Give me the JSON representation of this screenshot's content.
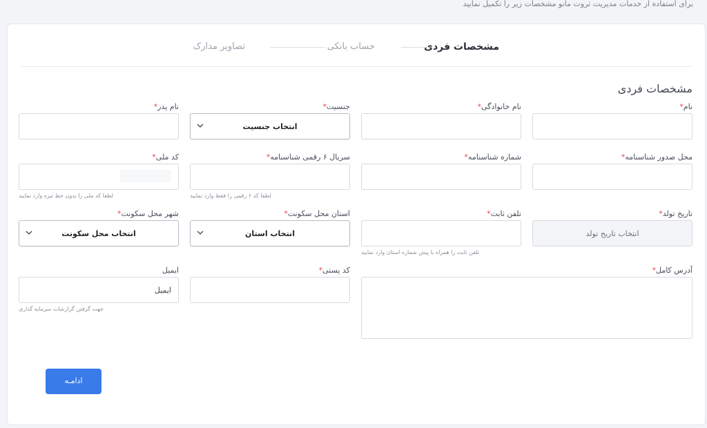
{
  "intro_text": "برای استفاده از خدمات مدیریت ثروت مانو مشخصات زیر را تکمیل نمایید",
  "steps": {
    "personal": "مشخصات فردی",
    "bank": "حساب بانکی",
    "documents": "تصاویر مدارک"
  },
  "section_title": "مشخصات فردی",
  "fields": {
    "first_name": {
      "label": "نام"
    },
    "last_name": {
      "label": "نام خانوادگی"
    },
    "gender": {
      "label": "جنسیت",
      "value": "انتخاب جنسیت"
    },
    "father_name": {
      "label": "نام پدر"
    },
    "issue_place": {
      "label": "محل صدور شناسنامه"
    },
    "id_number": {
      "label": "شماره شناسنامه"
    },
    "id_serial": {
      "label": "سریال ۶ رقمی شناسنامه",
      "hint": "لطفا کد ۶ رقمی را فقط وارد نمایید"
    },
    "national_code": {
      "label": "کد ملی",
      "hint": "لطفا کد ملی را بدون خط تیره وارد نمایید"
    },
    "birth_date": {
      "label": "تاریخ تولد",
      "placeholder": "انتخاب تاریخ تولد"
    },
    "landline": {
      "label": "تلفن ثابت",
      "hint": "تلفن ثابت را همراه با پیش شماره استان وارد نمایید"
    },
    "province": {
      "label": "استان محل سکونت",
      "value": "انتخاب استان"
    },
    "city": {
      "label": "شهر محل سکونت",
      "value": "انتخاب محل سکونت"
    },
    "address": {
      "label": "آدرس کامل"
    },
    "postal_code": {
      "label": "کد پستی"
    },
    "email": {
      "label": "ایمیل",
      "placeholder": "ایمیل",
      "hint": "جهت گرفتن گزارشات سرمایه گذاری"
    }
  },
  "continue_label": "ادامـه",
  "colors": {
    "primary": "#3a7bea",
    "required": "#e2474f"
  }
}
